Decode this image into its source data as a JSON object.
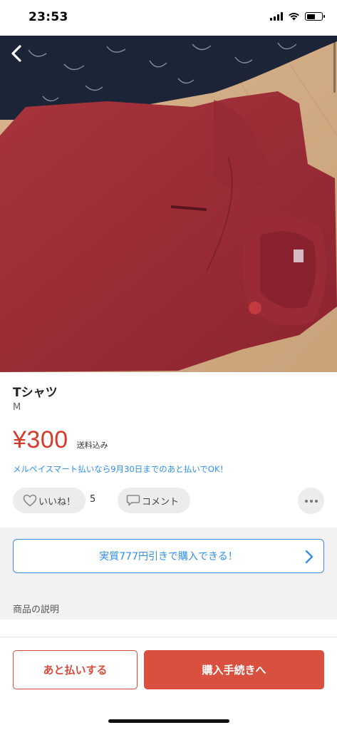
{
  "status_bar": {
    "time": "23:53"
  },
  "listing": {
    "title": "Tシャツ",
    "size": "M",
    "price": "¥300",
    "shipping": "送料込み",
    "promo": "メルペイスマート払いなら9月30日までのあと払いでOK！"
  },
  "actions": {
    "like_label": "いいね！",
    "like_count": "5",
    "comment_label": "コメント"
  },
  "discount_banner": {
    "label": "実質777円引きで購入できる！"
  },
  "description": {
    "header": "商品の説明"
  },
  "bottom_bar": {
    "after_pay_label": "あと払いする",
    "purchase_label": "購入手続きへ"
  },
  "colors": {
    "price_red": "#d83a2a",
    "primary_red": "#d9503f",
    "link_blue": "#2e8ff0"
  }
}
